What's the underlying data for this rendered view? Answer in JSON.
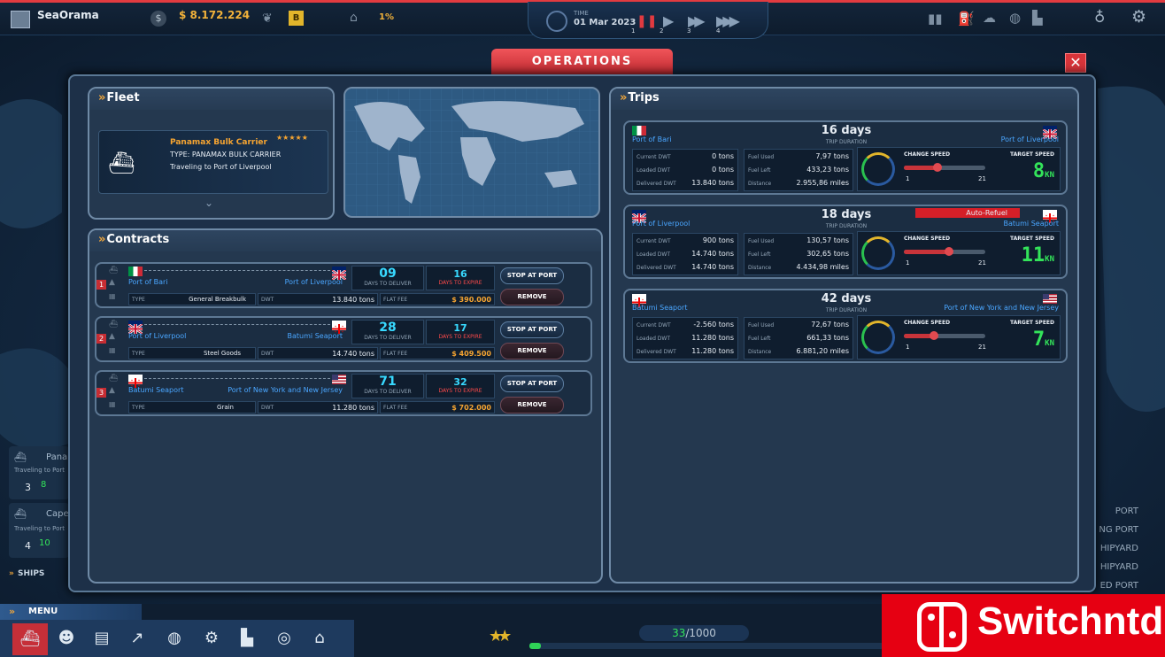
{
  "topbar": {
    "company": "SeaOrama",
    "money": "$ 8.172.224",
    "percent": "1%",
    "time_label": "TIME",
    "date": "01 Mar 2023",
    "speeds": [
      "1",
      "2",
      "3",
      "4"
    ]
  },
  "window": {
    "title": "OPERATIONS",
    "close": "✕"
  },
  "fleet": {
    "title": "Fleet",
    "ship_name": "Panamax Bulk Carrier",
    "ship_type": "TYPE: PANAMAX BULK CARRIER",
    "ship_status": "Traveling to Port of Liverpool",
    "stars": "★★★★★"
  },
  "contracts": {
    "title": "Contracts",
    "days_to_deliver_label": "DAYS TO DELIVER",
    "days_to_expire_label": "DAYS TO EXPIRE",
    "type_label": "TYPE",
    "dwt_label": "DWT",
    "fee_label": "FLAT FEE",
    "stop_label": "STOP AT PORT",
    "remove_label": "REMOVE",
    "items": [
      {
        "num": "1",
        "from": "Port of Bari",
        "to": "Port of Liverpool",
        "deliver": "09",
        "expire": "16",
        "type": "General Breakbulk",
        "dwt": "13.840 tons",
        "fee": "$ 390.000"
      },
      {
        "num": "2",
        "from": "Port of Liverpool",
        "to": "Batumi Seaport",
        "deliver": "28",
        "expire": "17",
        "type": "Steel Goods",
        "dwt": "14.740 tons",
        "fee": "$ 409.500"
      },
      {
        "num": "3",
        "from": "Batumi Seaport",
        "to": "Port of New York and New Jersey",
        "deliver": "71",
        "expire": "32",
        "type": "Grain",
        "dwt": "11.280 tons",
        "fee": "$ 702.000"
      }
    ]
  },
  "trips": {
    "title": "Trips",
    "duration_label": "TRIP DURATION",
    "current_dwt_label": "Current DWT",
    "loaded_dwt_label": "Loaded DWT",
    "delivered_dwt_label": "Delivered DWT",
    "fuel_used_label": "Fuel Used",
    "fuel_left_label": "Fuel Left",
    "distance_label": "Distance",
    "change_speed_label": "CHANGE SPEED",
    "target_speed_label": "TARGET SPEED",
    "speed_min": "1",
    "speed_max": "21",
    "kn": "KN",
    "auto_refuel": "Auto-Refuel",
    "items": [
      {
        "from": "Port of Bari",
        "to": "Port of Liverpool",
        "duration": "16 days",
        "current_dwt": "0 tons",
        "loaded_dwt": "0 tons",
        "delivered_dwt": "13.840 tons",
        "fuel_used": "7,97 tons",
        "fuel_left": "433,23 tons",
        "distance": "2.955,86 miles",
        "target_speed": "8",
        "speed_fraction": 0.35
      },
      {
        "from": "Port of Liverpool",
        "to": "Batumi Seaport",
        "duration": "18 days",
        "current_dwt": "900 tons",
        "loaded_dwt": "14.740 tons",
        "delivered_dwt": "14.740 tons",
        "fuel_used": "130,57 tons",
        "fuel_left": "302,65 tons",
        "distance": "4.434,98 miles",
        "target_speed": "11",
        "speed_fraction": 0.5
      },
      {
        "from": "Batumi Seaport",
        "to": "Port of New York and New Jersey",
        "duration": "42 days",
        "current_dwt": "-2.560 tons",
        "loaded_dwt": "11.280 tons",
        "delivered_dwt": "11.280 tons",
        "fuel_used": "72,67 tons",
        "fuel_left": "661,33 tons",
        "distance": "6.881,20 miles",
        "target_speed": "7",
        "speed_fraction": 0.3
      }
    ]
  },
  "left_side": {
    "ship1_name": "Pana",
    "ship1_status": "Traveling to Port",
    "ship1_count": "3",
    "ship1_speed": "8",
    "ship2_name": "Cape",
    "ship2_status": "Traveling to Port",
    "ship2_count": "4",
    "ship2_speed": "10",
    "ships_label": "SHIPS"
  },
  "right_side": [
    "PORT",
    "NG PORT",
    "HIPYARD",
    "HIPYARD",
    "ED PORT"
  ],
  "bottom": {
    "menu": "MENU",
    "progress": "33/1000",
    "progress_current": "33",
    "progress_total": "/1000",
    "progress_fraction": 0.033
  },
  "watermark": "Switchntd"
}
